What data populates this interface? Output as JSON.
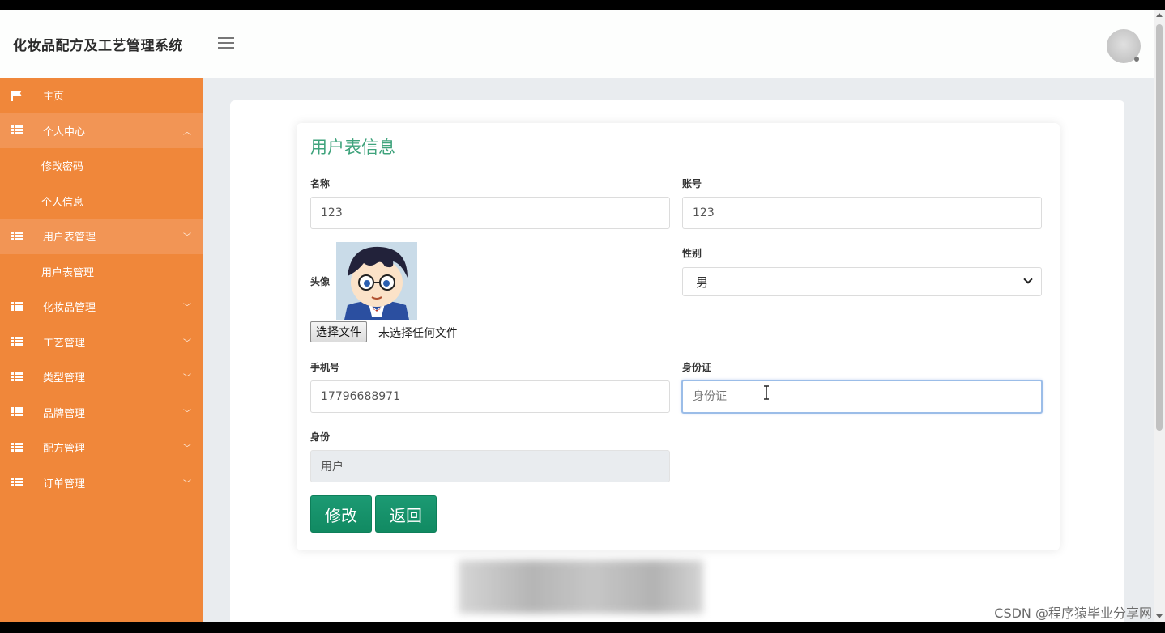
{
  "header": {
    "title": "化妆品配方及工艺管理系统"
  },
  "sidebar": {
    "items": [
      {
        "label": "主页"
      },
      {
        "label": "个人中心"
      },
      {
        "label": "修改密码"
      },
      {
        "label": "个人信息"
      },
      {
        "label": "用户表管理"
      },
      {
        "label": "用户表管理"
      },
      {
        "label": "化妆品管理"
      },
      {
        "label": "工艺管理"
      },
      {
        "label": "类型管理"
      },
      {
        "label": "品牌管理"
      },
      {
        "label": "配方管理"
      },
      {
        "label": "订单管理"
      }
    ]
  },
  "form": {
    "title": "用户表信息",
    "name_label": "名称",
    "name_value": "123",
    "account_label": "账号",
    "account_value": "123",
    "avatar_label": "头像",
    "file_button": "选择文件",
    "file_status": "未选择任何文件",
    "gender_label": "性别",
    "gender_value": "男",
    "phone_label": "手机号",
    "phone_value": "17796688971",
    "idcard_label": "身份证",
    "idcard_placeholder": "身份证",
    "role_label": "身份",
    "role_value": "用户",
    "submit_label": "修改",
    "back_label": "返回"
  },
  "watermark": "CSDN @程序猿毕业分享网",
  "colors": {
    "sidebar": "#f0873a",
    "accent": "#3fa37c",
    "button": "#118a62"
  }
}
